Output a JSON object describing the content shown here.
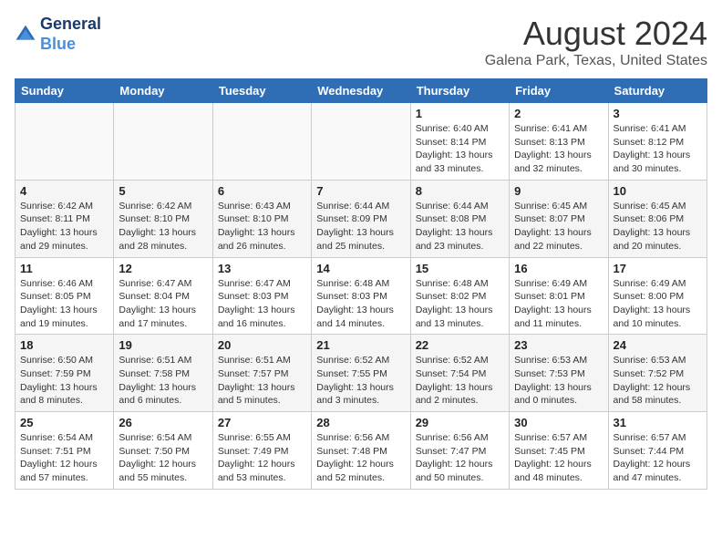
{
  "header": {
    "logo_line1": "General",
    "logo_line2": "Blue",
    "month_title": "August 2024",
    "location": "Galena Park, Texas, United States"
  },
  "days_of_week": [
    "Sunday",
    "Monday",
    "Tuesday",
    "Wednesday",
    "Thursday",
    "Friday",
    "Saturday"
  ],
  "weeks": [
    [
      {
        "day": "",
        "content": ""
      },
      {
        "day": "",
        "content": ""
      },
      {
        "day": "",
        "content": ""
      },
      {
        "day": "",
        "content": ""
      },
      {
        "day": "1",
        "content": "Sunrise: 6:40 AM\nSunset: 8:14 PM\nDaylight: 13 hours\nand 33 minutes."
      },
      {
        "day": "2",
        "content": "Sunrise: 6:41 AM\nSunset: 8:13 PM\nDaylight: 13 hours\nand 32 minutes."
      },
      {
        "day": "3",
        "content": "Sunrise: 6:41 AM\nSunset: 8:12 PM\nDaylight: 13 hours\nand 30 minutes."
      }
    ],
    [
      {
        "day": "4",
        "content": "Sunrise: 6:42 AM\nSunset: 8:11 PM\nDaylight: 13 hours\nand 29 minutes."
      },
      {
        "day": "5",
        "content": "Sunrise: 6:42 AM\nSunset: 8:10 PM\nDaylight: 13 hours\nand 28 minutes."
      },
      {
        "day": "6",
        "content": "Sunrise: 6:43 AM\nSunset: 8:10 PM\nDaylight: 13 hours\nand 26 minutes."
      },
      {
        "day": "7",
        "content": "Sunrise: 6:44 AM\nSunset: 8:09 PM\nDaylight: 13 hours\nand 25 minutes."
      },
      {
        "day": "8",
        "content": "Sunrise: 6:44 AM\nSunset: 8:08 PM\nDaylight: 13 hours\nand 23 minutes."
      },
      {
        "day": "9",
        "content": "Sunrise: 6:45 AM\nSunset: 8:07 PM\nDaylight: 13 hours\nand 22 minutes."
      },
      {
        "day": "10",
        "content": "Sunrise: 6:45 AM\nSunset: 8:06 PM\nDaylight: 13 hours\nand 20 minutes."
      }
    ],
    [
      {
        "day": "11",
        "content": "Sunrise: 6:46 AM\nSunset: 8:05 PM\nDaylight: 13 hours\nand 19 minutes."
      },
      {
        "day": "12",
        "content": "Sunrise: 6:47 AM\nSunset: 8:04 PM\nDaylight: 13 hours\nand 17 minutes."
      },
      {
        "day": "13",
        "content": "Sunrise: 6:47 AM\nSunset: 8:03 PM\nDaylight: 13 hours\nand 16 minutes."
      },
      {
        "day": "14",
        "content": "Sunrise: 6:48 AM\nSunset: 8:03 PM\nDaylight: 13 hours\nand 14 minutes."
      },
      {
        "day": "15",
        "content": "Sunrise: 6:48 AM\nSunset: 8:02 PM\nDaylight: 13 hours\nand 13 minutes."
      },
      {
        "day": "16",
        "content": "Sunrise: 6:49 AM\nSunset: 8:01 PM\nDaylight: 13 hours\nand 11 minutes."
      },
      {
        "day": "17",
        "content": "Sunrise: 6:49 AM\nSunset: 8:00 PM\nDaylight: 13 hours\nand 10 minutes."
      }
    ],
    [
      {
        "day": "18",
        "content": "Sunrise: 6:50 AM\nSunset: 7:59 PM\nDaylight: 13 hours\nand 8 minutes."
      },
      {
        "day": "19",
        "content": "Sunrise: 6:51 AM\nSunset: 7:58 PM\nDaylight: 13 hours\nand 6 minutes."
      },
      {
        "day": "20",
        "content": "Sunrise: 6:51 AM\nSunset: 7:57 PM\nDaylight: 13 hours\nand 5 minutes."
      },
      {
        "day": "21",
        "content": "Sunrise: 6:52 AM\nSunset: 7:55 PM\nDaylight: 13 hours\nand 3 minutes."
      },
      {
        "day": "22",
        "content": "Sunrise: 6:52 AM\nSunset: 7:54 PM\nDaylight: 13 hours\nand 2 minutes."
      },
      {
        "day": "23",
        "content": "Sunrise: 6:53 AM\nSunset: 7:53 PM\nDaylight: 13 hours\nand 0 minutes."
      },
      {
        "day": "24",
        "content": "Sunrise: 6:53 AM\nSunset: 7:52 PM\nDaylight: 12 hours\nand 58 minutes."
      }
    ],
    [
      {
        "day": "25",
        "content": "Sunrise: 6:54 AM\nSunset: 7:51 PM\nDaylight: 12 hours\nand 57 minutes."
      },
      {
        "day": "26",
        "content": "Sunrise: 6:54 AM\nSunset: 7:50 PM\nDaylight: 12 hours\nand 55 minutes."
      },
      {
        "day": "27",
        "content": "Sunrise: 6:55 AM\nSunset: 7:49 PM\nDaylight: 12 hours\nand 53 minutes."
      },
      {
        "day": "28",
        "content": "Sunrise: 6:56 AM\nSunset: 7:48 PM\nDaylight: 12 hours\nand 52 minutes."
      },
      {
        "day": "29",
        "content": "Sunrise: 6:56 AM\nSunset: 7:47 PM\nDaylight: 12 hours\nand 50 minutes."
      },
      {
        "day": "30",
        "content": "Sunrise: 6:57 AM\nSunset: 7:45 PM\nDaylight: 12 hours\nand 48 minutes."
      },
      {
        "day": "31",
        "content": "Sunrise: 6:57 AM\nSunset: 7:44 PM\nDaylight: 12 hours\nand 47 minutes."
      }
    ]
  ]
}
